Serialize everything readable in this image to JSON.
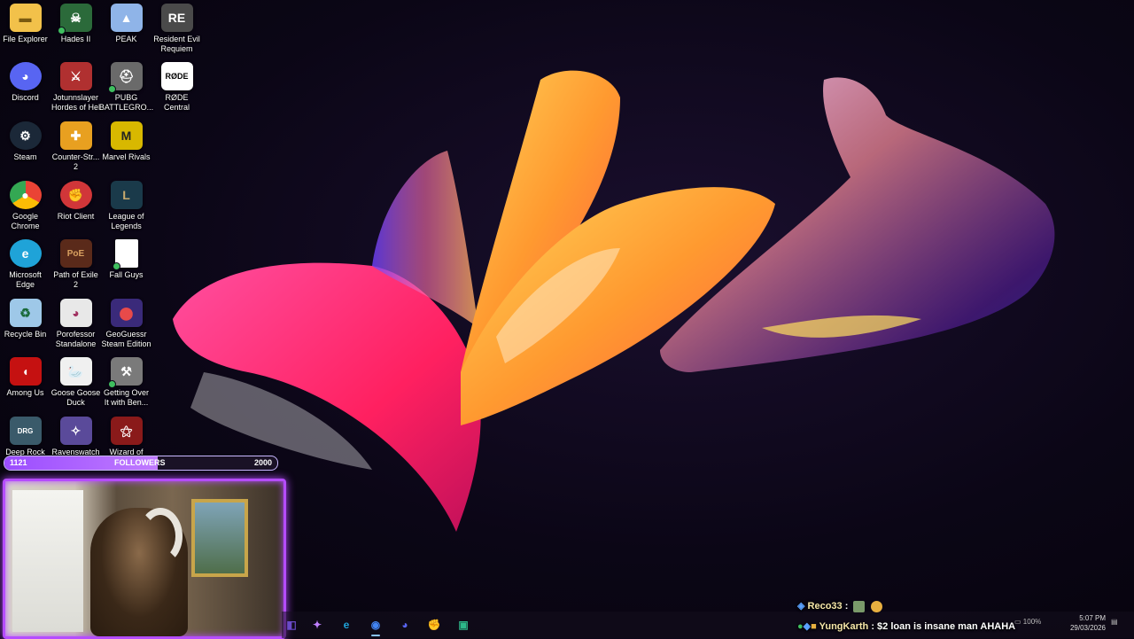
{
  "desktop": {
    "icons": [
      {
        "label": "File Explorer",
        "icon": "folder-icon",
        "color": "#f2c14a"
      },
      {
        "label": "Hades II",
        "icon": "hades-icon",
        "color": "#2b6a3a"
      },
      {
        "label": "PEAK",
        "icon": "peak-icon",
        "color": "#8fb4e8"
      },
      {
        "label": "Resident Evil Requiem",
        "icon": "resident-evil-icon",
        "color": "#4a4a4a"
      },
      {
        "label": "Discord",
        "icon": "discord-icon",
        "color": "#5865f2"
      },
      {
        "label": "Jotunnslayer Hordes of Hel",
        "icon": "jotunnslayer-icon",
        "color": "#b03030"
      },
      {
        "label": "PUBG BATTLEGRO...",
        "icon": "pubg-icon",
        "color": "#6a6a6a"
      },
      {
        "label": "RØDE Central",
        "icon": "rode-icon",
        "color": "#ffffff"
      },
      {
        "label": "Steam",
        "icon": "steam-icon",
        "color": "#1b2838"
      },
      {
        "label": "Counter-Str... 2",
        "icon": "counter-strike-icon",
        "color": "#e8a020"
      },
      {
        "label": "Marvel Rivals",
        "icon": "marvel-rivals-icon",
        "color": "#d8b800"
      },
      {
        "label": "Google Chrome",
        "icon": "chrome-icon",
        "color": "#4285f4"
      },
      {
        "label": "Riot Client",
        "icon": "riot-icon",
        "color": "#d13639"
      },
      {
        "label": "League of Legends",
        "icon": "league-icon",
        "color": "#1a3a4a"
      },
      {
        "label": "Microsoft Edge",
        "icon": "edge-icon",
        "color": "#1fa3d8"
      },
      {
        "label": "Path of Exile 2",
        "icon": "poe-icon",
        "color": "#5a2a1a"
      },
      {
        "label": "Fall Guys",
        "icon": "file-icon",
        "color": "#ffffff"
      },
      {
        "label": "Recycle Bin",
        "icon": "recycle-bin-icon",
        "color": "#9ec8e8"
      },
      {
        "label": "Porofessor Standalone",
        "icon": "porofessor-icon",
        "color": "#e8e8e8"
      },
      {
        "label": "GeoGuessr Steam Edition",
        "icon": "geoguessr-icon",
        "color": "#3a2a7a"
      },
      {
        "label": "Among Us",
        "icon": "among-us-icon",
        "color": "#c51111"
      },
      {
        "label": "Goose Goose Duck",
        "icon": "goose-icon",
        "color": "#f0f0f0"
      },
      {
        "label": "Getting Over It with Ben...",
        "icon": "hammer-icon",
        "color": "#7a7a7a"
      },
      {
        "label": "Deep Rock",
        "icon": "deep-rock-icon",
        "color": "#3a5a6a"
      },
      {
        "label": "Ravenswatch",
        "icon": "ravenswatch-icon",
        "color": "#5a4a9a"
      },
      {
        "label": "Wizard of",
        "icon": "wizard-icon",
        "color": "#8a1a1a"
      }
    ]
  },
  "followers": {
    "current": "1121",
    "label": "FOLLOWERS",
    "goal": "2000",
    "progress": 0.5605
  },
  "chat": {
    "msg1": {
      "user": "Reco33",
      "text": ":"
    },
    "msg2": {
      "user": "YungKarth",
      "text": ": $2 loan is insane man AHAHA"
    }
  },
  "taskbar": {
    "apps": [
      {
        "name": "visual-studio-icon",
        "color": "#6a4ac8",
        "glyph": "◧"
      },
      {
        "name": "copilot-icon",
        "color": "#c080ff",
        "glyph": "✦"
      },
      {
        "name": "edge-icon",
        "color": "#1fa3d8",
        "glyph": "e"
      },
      {
        "name": "chrome-icon",
        "color": "#4285f4",
        "glyph": "◉"
      },
      {
        "name": "discord-icon",
        "color": "#5865f2",
        "glyph": "◕"
      },
      {
        "name": "riot-icon",
        "color": "#d13639",
        "glyph": "✊"
      },
      {
        "name": "app-icon",
        "color": "#2db88a",
        "glyph": "▣"
      }
    ],
    "battery": "100%",
    "time": "5:07 PM",
    "date": "29/03/2026"
  }
}
